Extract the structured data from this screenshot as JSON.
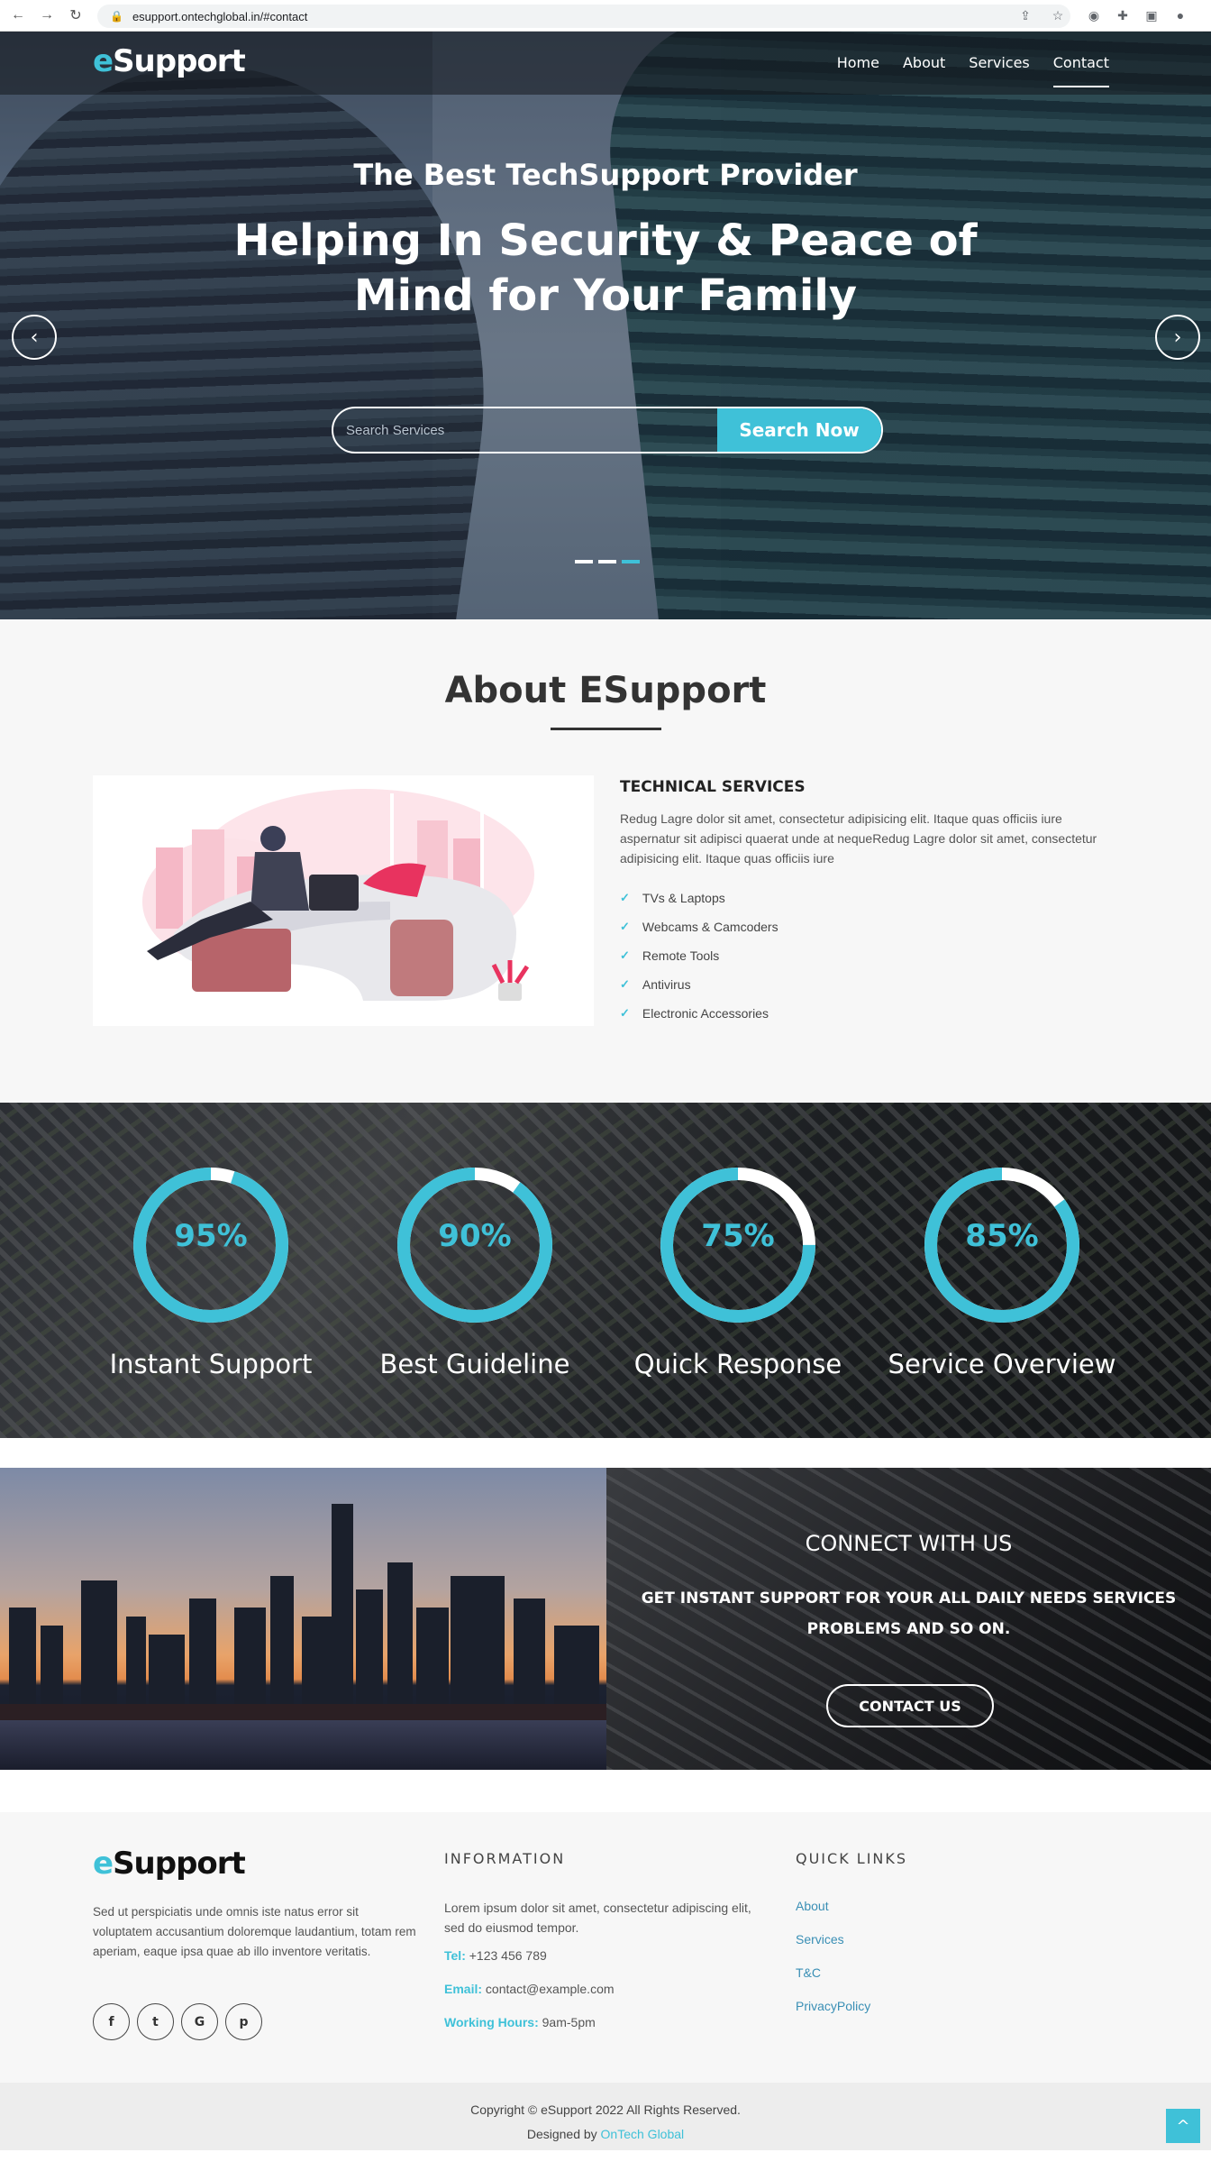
{
  "browser": {
    "url": "esupport.ontechglobal.in/#contact"
  },
  "nav": {
    "logo_e": "e",
    "logo_rest": "Support",
    "items": [
      {
        "label": "Home"
      },
      {
        "label": "About"
      },
      {
        "label": "Services"
      },
      {
        "label": "Contact"
      }
    ],
    "active": "Contact"
  },
  "hero": {
    "subtitle": "The Best TechSupport Provider",
    "title": "Helping In Security & Peace of Mind for Your Family",
    "search_placeholder": "Search Services",
    "search_button": "Search Now",
    "prev_icon": "‹",
    "next_icon": "›",
    "active_slide": 3,
    "slide_count": 3
  },
  "about": {
    "heading": "About ESupport",
    "tech_heading": "TECHNICAL SERVICES",
    "tech_text": "Redug Lagre dolor sit amet, consectetur adipisicing elit. Itaque quas officiis iure aspernatur sit adipisci quaerat unde at nequeRedug Lagre dolor sit amet, consectetur adipisicing elit. Itaque quas officiis iure",
    "items": [
      "TVs & Laptops",
      "Webcams & Camcoders",
      "Remote Tools",
      "Antivirus",
      "Electronic Accessories"
    ]
  },
  "stats": [
    {
      "value": 95,
      "text": "95%",
      "label": "Instant Support"
    },
    {
      "value": 90,
      "text": "90%",
      "label": "Best Guideline"
    },
    {
      "value": 75,
      "text": "75%",
      "label": "Quick Response"
    },
    {
      "value": 85,
      "text": "85%",
      "label": "Service Overview"
    }
  ],
  "connect": {
    "heading": "CONNECT WITH US",
    "text": "GET INSTANT SUPPORT FOR YOUR ALL DAILY NEEDS SERVICES PROBLEMS AND SO ON.",
    "button": "CONTACT US"
  },
  "footer": {
    "logo_e": "e",
    "logo_rest": "Support",
    "description": "Sed ut perspiciatis unde omnis iste natus error sit voluptatem accusantium doloremque laudantium, totam rem aperiam, eaque ipsa quae ab illo inventore veritatis.",
    "socials": [
      {
        "icon": "facebook-icon",
        "glyph": "f"
      },
      {
        "icon": "twitter-icon",
        "glyph": "t"
      },
      {
        "icon": "google-icon",
        "glyph": "G"
      },
      {
        "icon": "pinterest-icon",
        "glyph": "p"
      }
    ],
    "info_heading": "INFORMATION",
    "info_text": "Lorem ipsum dolor sit amet, consectetur adipiscing elit, sed do eiusmod tempor.",
    "tel_label": "Tel:",
    "tel_value": "+123 456 789",
    "email_label": "Email:",
    "email_value": "contact@example.com",
    "hours_label": "Working Hours:",
    "hours_value": "9am-5pm",
    "quick_heading": "QUICK LINKS",
    "quick_links": [
      "About",
      "Services",
      "T&C",
      "PrivacyPolicy"
    ],
    "copyright": "Copyright © eSupport 2022 All Rights Reserved.",
    "designed_by": "Designed by",
    "designer": "OnTech Global",
    "to_top_icon": "^"
  },
  "colors": {
    "accent": "#3fc1d8",
    "ring_track": "#ffffff"
  }
}
